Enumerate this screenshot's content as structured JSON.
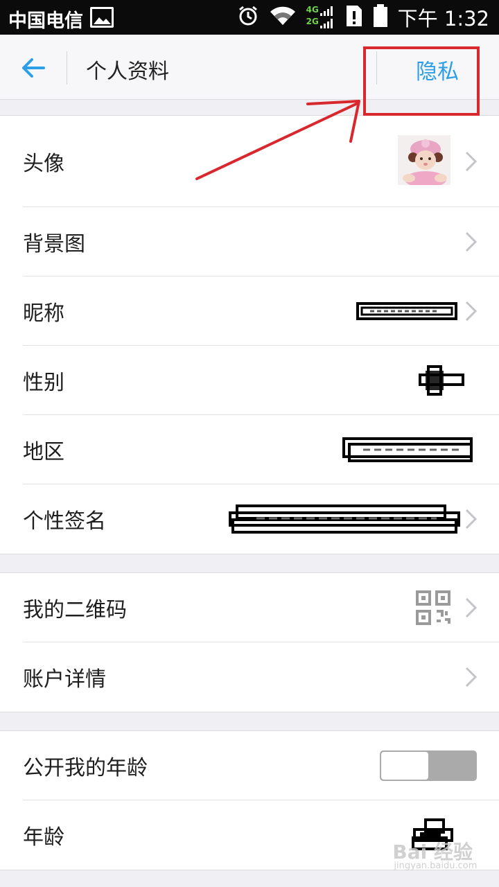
{
  "status_bar": {
    "carrier": "中国电信",
    "network_top": "4G",
    "network_bottom": "2G",
    "time": "下午 1:32"
  },
  "header": {
    "title": "个人资料",
    "privacy_label": "隐私"
  },
  "profile": {
    "avatar_label": "头像",
    "background_label": "背景图",
    "nickname_label": "昵称",
    "gender_label": "性别",
    "region_label": "地区",
    "signature_label": "个性签名"
  },
  "account": {
    "qrcode_label": "我的二维码",
    "details_label": "账户详情"
  },
  "age": {
    "public_age_label": "公开我的年龄",
    "public_age_on": false,
    "age_label": "年龄"
  },
  "watermark": {
    "brand": "Bai 经验",
    "url": "jingyan.baidu.com"
  },
  "colors": {
    "accent": "#2d9fe6",
    "annotation": "#d9272e",
    "toggle_off": "#a9aaa9"
  }
}
